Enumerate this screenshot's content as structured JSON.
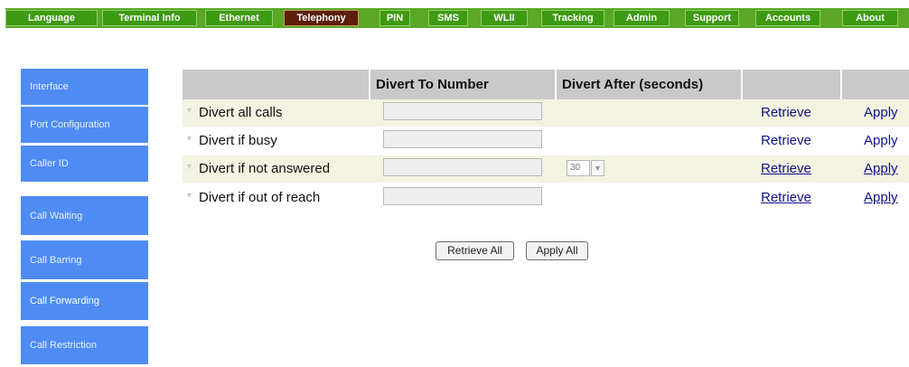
{
  "nav": {
    "tabs": [
      {
        "label": "Language",
        "active": false
      },
      {
        "label": "Terminal Info",
        "active": false
      },
      {
        "label": "Ethernet",
        "active": false
      },
      {
        "label": "Telephony",
        "active": true
      },
      {
        "label": "PIN",
        "active": false
      },
      {
        "label": "SMS",
        "active": false
      },
      {
        "label": "WLII",
        "active": false
      },
      {
        "label": "Tracking",
        "active": false
      },
      {
        "label": "Admin",
        "active": false
      },
      {
        "label": "Support",
        "active": false
      },
      {
        "label": "Accounts",
        "active": false
      },
      {
        "label": "About",
        "active": false
      }
    ]
  },
  "sidebar": {
    "items": [
      {
        "label": "Interface",
        "active": false
      },
      {
        "label": "Port Configuration",
        "active": false
      },
      {
        "label": "Caller ID",
        "active": false
      },
      {
        "label": "Call Waiting",
        "active": false
      },
      {
        "label": "Call Barring",
        "active": false
      },
      {
        "label": "Call Forwarding",
        "active": true
      },
      {
        "label": "Call Restriction",
        "active": false
      }
    ]
  },
  "table": {
    "headers": [
      "",
      "Divert To Number",
      "Divert After (seconds)",
      "",
      ""
    ],
    "rows": [
      {
        "label": "Divert all calls",
        "number": "",
        "has_seconds": false,
        "seconds": "",
        "retrieve": "Retrieve",
        "apply": "Apply"
      },
      {
        "label": "Divert if busy",
        "number": "",
        "has_seconds": false,
        "seconds": "",
        "retrieve": "Retrieve",
        "apply": "Apply"
      },
      {
        "label": "Divert if not answered",
        "number": "",
        "has_seconds": true,
        "seconds": "30",
        "retrieve": "Retrieve",
        "apply": "Apply"
      },
      {
        "label": "Divert if out of reach",
        "number": "",
        "has_seconds": false,
        "seconds": "",
        "retrieve": "Retrieve",
        "apply": "Apply"
      }
    ]
  },
  "actions": {
    "retrieve_all": "Retrieve All",
    "apply_all": "Apply All"
  },
  "icons": {
    "row_arrow": "collapse-arrow-icon",
    "select_arrow": "chevron-down-icon"
  },
  "colors": {
    "nav_green": "#3e9a12",
    "nav_active": "#5b1f0a",
    "sidebar_blue": "#4e8cf4",
    "header_gray": "#c9c9c9",
    "row_shade": "#f3f3e0",
    "link": "#10108a"
  }
}
